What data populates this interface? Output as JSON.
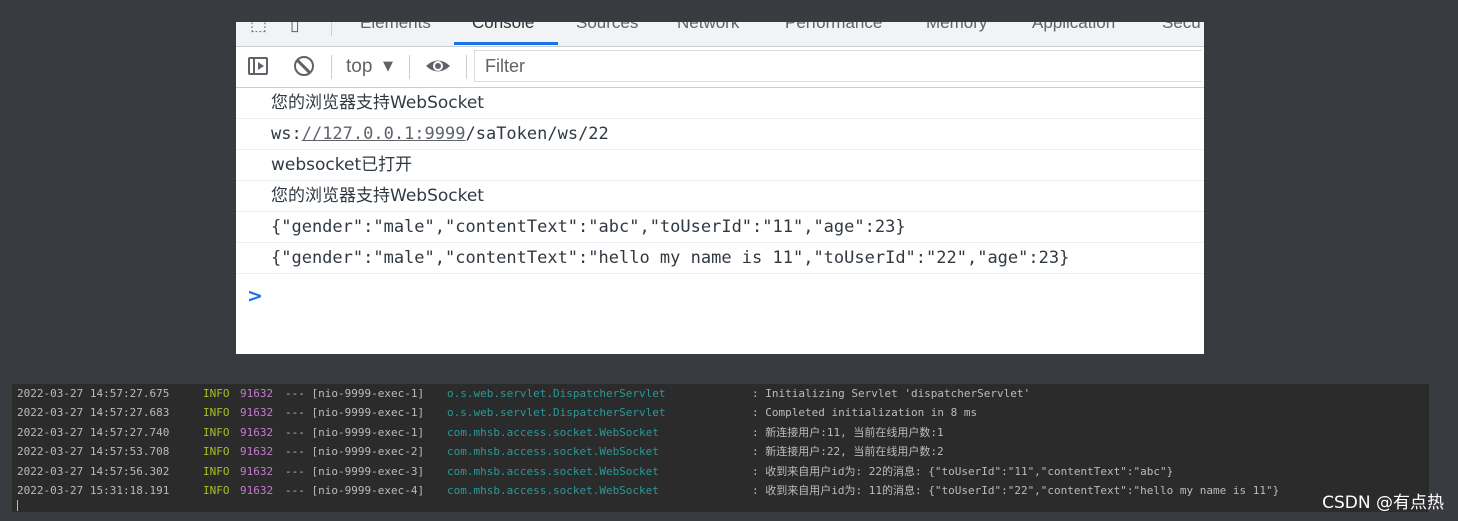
{
  "devtools": {
    "tabs": [
      "Elements",
      "Console",
      "Sources",
      "Network",
      "Performance",
      "Memory",
      "Application",
      "Secu"
    ],
    "active_tab": "Console",
    "toolbar": {
      "context": "top",
      "filter_placeholder": "Filter"
    },
    "console_messages": [
      {
        "text": "您的浏览器支持WebSocket"
      },
      {
        "prefix": "ws:",
        "link": "//127.0.0.1:9999",
        "suffix": "/saToken/ws/22"
      },
      {
        "text": "websocket已打开"
      },
      {
        "text": "您的浏览器支持WebSocket"
      },
      {
        "text": "{\"gender\":\"male\",\"contentText\":\"abc\",\"toUserId\":\"11\",\"age\":23}"
      },
      {
        "text": "{\"gender\":\"male\",\"contentText\":\"hello my name is 11\",\"toUserId\":\"22\",\"age\":23}"
      }
    ],
    "prompt": ">"
  },
  "log": {
    "rows": [
      {
        "time": "2022-03-27 14:57:27.675",
        "level": "INFO",
        "pid": "91632",
        "thread": "--- [nio-9999-exec-1]",
        "logger": "o.s.web.servlet.DispatcherServlet",
        "message": ": Initializing Servlet 'dispatcherServlet'"
      },
      {
        "time": "2022-03-27 14:57:27.683",
        "level": "INFO",
        "pid": "91632",
        "thread": "--- [nio-9999-exec-1]",
        "logger": "o.s.web.servlet.DispatcherServlet",
        "message": ": Completed initialization in 8 ms"
      },
      {
        "time": "2022-03-27 14:57:27.740",
        "level": "INFO",
        "pid": "91632",
        "thread": "--- [nio-9999-exec-1]",
        "logger": "com.mhsb.access.socket.WebSocket",
        "message": ": 新连接用户:11, 当前在线用户数:1"
      },
      {
        "time": "2022-03-27 14:57:53.708",
        "level": "INFO",
        "pid": "91632",
        "thread": "--- [nio-9999-exec-2]",
        "logger": "com.mhsb.access.socket.WebSocket",
        "message": ": 新连接用户:22, 当前在线用户数:2"
      },
      {
        "time": "2022-03-27 14:57:56.302",
        "level": "INFO",
        "pid": "91632",
        "thread": "--- [nio-9999-exec-3]",
        "logger": "com.mhsb.access.socket.WebSocket",
        "message": ": 收到来自用户id为: 22的消息: {\"toUserId\":\"11\",\"contentText\":\"abc\"}"
      },
      {
        "time": "2022-03-27 15:31:18.191",
        "level": "INFO",
        "pid": "91632",
        "thread": "--- [nio-9999-exec-4]",
        "logger": "com.mhsb.access.socket.WebSocket",
        "message": ": 收到来自用户id为: 11的消息: {\"toUserId\":\"22\",\"contentText\":\"hello my name is 11\"}"
      }
    ]
  },
  "watermark": "CSDN @有点热"
}
